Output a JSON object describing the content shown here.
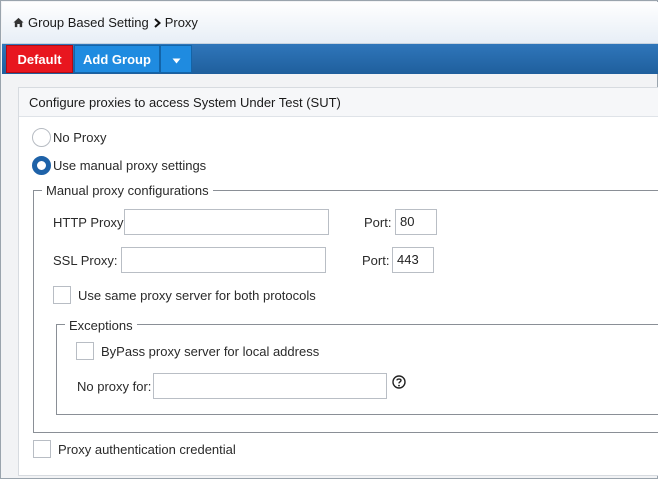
{
  "breadcrumb": {
    "root": "Group Based Setting",
    "current": "Proxy"
  },
  "toolbar": {
    "default_label": "Default",
    "add_group_label": "Add Group"
  },
  "colors": {
    "default_button": "#e8161f",
    "add_group_button": "#1f8be0",
    "toolbar": "#2a6db0",
    "radio_selected": "#1e62a8"
  },
  "panel": {
    "title": "Configure proxies to access System Under Test (SUT)",
    "no_proxy_label": "No Proxy",
    "manual_label": "Use manual proxy settings",
    "selected": "manual"
  },
  "manual": {
    "legend": "Manual proxy configurations",
    "http_label": "HTTP Proxy:",
    "http_value": "",
    "http_port_label": "Port:",
    "http_port_value": "80",
    "ssl_label": "SSL Proxy:",
    "ssl_value": "",
    "ssl_port_label": "Port:",
    "ssl_port_value": "443",
    "same_proxy_label": "Use same proxy server for both protocols",
    "same_proxy_checked": false
  },
  "exceptions": {
    "legend": "Exceptions",
    "bypass_label": "ByPass proxy server for local address",
    "bypass_checked": false,
    "no_proxy_label": "No proxy for:",
    "no_proxy_value": ""
  },
  "auth": {
    "label": "Proxy authentication credential",
    "checked": false
  },
  "icons": {
    "home": "home-icon",
    "breadcrumb_separator": "chevron-right-icon",
    "dropdown": "caret-down-icon",
    "help": "question-circle-icon"
  }
}
